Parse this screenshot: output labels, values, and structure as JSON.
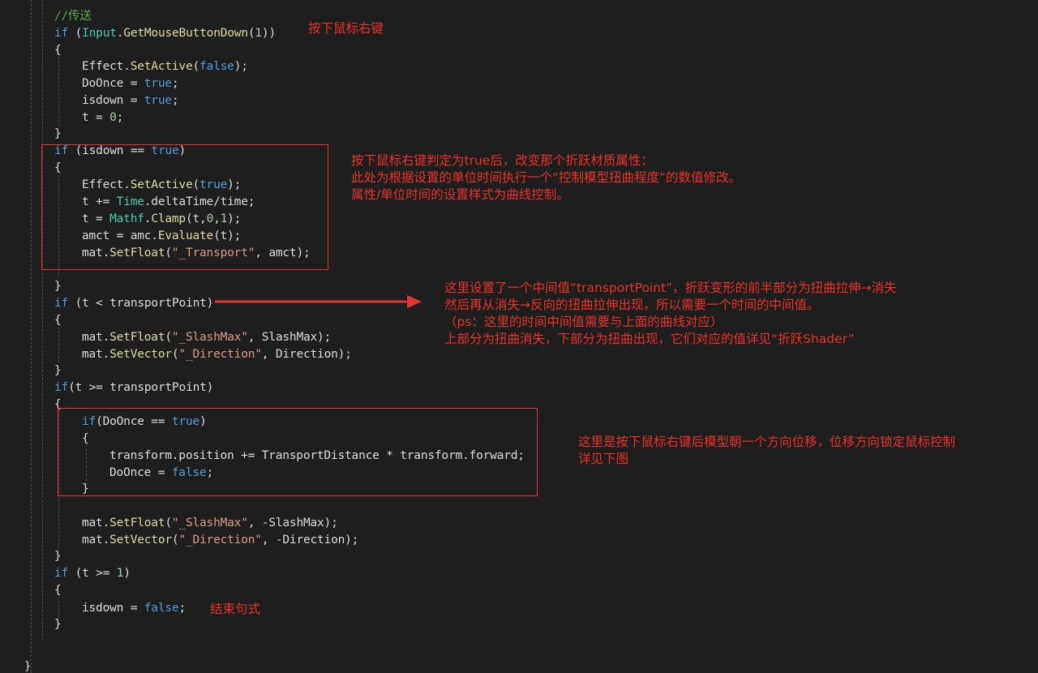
{
  "code_lines": [
    {
      "tokens": [
        {
          "t": "//传送",
          "c": "cm"
        }
      ]
    },
    {
      "tokens": [
        {
          "t": "if",
          "c": "kw"
        },
        {
          "t": " ("
        },
        {
          "t": "Input",
          "c": "ty"
        },
        {
          "t": "."
        },
        {
          "t": "GetMouseButtonDown",
          "c": "mt"
        },
        {
          "t": "("
        },
        {
          "t": "1",
          "c": "nm"
        },
        {
          "t": "))"
        }
      ]
    },
    {
      "tokens": [
        {
          "t": "{"
        }
      ]
    },
    {
      "tokens": [
        {
          "t": "Effect."
        },
        {
          "t": "SetActive",
          "c": "mt"
        },
        {
          "t": "("
        },
        {
          "t": "false",
          "c": "kw"
        },
        {
          "t": ");"
        }
      ]
    },
    {
      "tokens": [
        {
          "t": "DoOnce = "
        },
        {
          "t": "true",
          "c": "kw"
        },
        {
          "t": ";"
        }
      ]
    },
    {
      "tokens": [
        {
          "t": "isdown = "
        },
        {
          "t": "true",
          "c": "kw"
        },
        {
          "t": ";"
        }
      ]
    },
    {
      "tokens": [
        {
          "t": "t = "
        },
        {
          "t": "0",
          "c": "nm"
        },
        {
          "t": ";"
        }
      ]
    },
    {
      "tokens": [
        {
          "t": "}"
        }
      ]
    },
    {
      "tokens": [
        {
          "t": "if",
          "c": "kw"
        },
        {
          "t": " (isdown == "
        },
        {
          "t": "true",
          "c": "kw"
        },
        {
          "t": ")"
        }
      ]
    },
    {
      "tokens": [
        {
          "t": "{"
        }
      ]
    },
    {
      "tokens": [
        {
          "t": "Effect."
        },
        {
          "t": "SetActive",
          "c": "mt"
        },
        {
          "t": "("
        },
        {
          "t": "true",
          "c": "kw"
        },
        {
          "t": ");"
        }
      ]
    },
    {
      "tokens": [
        {
          "t": "t += "
        },
        {
          "t": "Time",
          "c": "ty"
        },
        {
          "t": ".deltaTime/time;"
        }
      ]
    },
    {
      "tokens": [
        {
          "t": "t = "
        },
        {
          "t": "Mathf",
          "c": "ty"
        },
        {
          "t": "."
        },
        {
          "t": "Clamp",
          "c": "mt"
        },
        {
          "t": "(t,"
        },
        {
          "t": "0",
          "c": "nm"
        },
        {
          "t": ","
        },
        {
          "t": "1",
          "c": "nm"
        },
        {
          "t": ");"
        }
      ]
    },
    {
      "tokens": [
        {
          "t": "amct = amc."
        },
        {
          "t": "Evaluate",
          "c": "mt"
        },
        {
          "t": "(t);"
        }
      ]
    },
    {
      "tokens": [
        {
          "t": "mat."
        },
        {
          "t": "SetFloat",
          "c": "mt"
        },
        {
          "t": "("
        },
        {
          "t": "\"_Transport\"",
          "c": "st"
        },
        {
          "t": ", amct);"
        }
      ]
    },
    {
      "tokens": [
        {
          "t": "}"
        }
      ]
    },
    {
      "tokens": [
        {
          "t": "if",
          "c": "kw"
        },
        {
          "t": " (t < transportPoint)"
        }
      ]
    },
    {
      "tokens": [
        {
          "t": "{"
        }
      ]
    },
    {
      "tokens": [
        {
          "t": "mat."
        },
        {
          "t": "SetFloat",
          "c": "mt"
        },
        {
          "t": "("
        },
        {
          "t": "\"_SlashMax\"",
          "c": "st"
        },
        {
          "t": ", SlashMax);"
        }
      ]
    },
    {
      "tokens": [
        {
          "t": "mat."
        },
        {
          "t": "SetVector",
          "c": "mt"
        },
        {
          "t": "("
        },
        {
          "t": "\"_Direction\"",
          "c": "st"
        },
        {
          "t": ", Direction);"
        }
      ]
    },
    {
      "tokens": [
        {
          "t": "}"
        }
      ]
    },
    {
      "tokens": [
        {
          "t": "if",
          "c": "kw"
        },
        {
          "t": "(t >= transportPoint)"
        }
      ]
    },
    {
      "tokens": [
        {
          "t": "{"
        }
      ]
    },
    {
      "tokens": [
        {
          "t": "if",
          "c": "kw"
        },
        {
          "t": "(DoOnce == "
        },
        {
          "t": "true",
          "c": "kw"
        },
        {
          "t": ")"
        }
      ]
    },
    {
      "tokens": [
        {
          "t": "{"
        }
      ]
    },
    {
      "tokens": [
        {
          "t": "transform.position += TransportDistance * transform.forward;"
        }
      ]
    },
    {
      "tokens": [
        {
          "t": "DoOnce = "
        },
        {
          "t": "false",
          "c": "kw"
        },
        {
          "t": ";"
        }
      ]
    },
    {
      "tokens": [
        {
          "t": "}"
        }
      ]
    },
    {
      "tokens": [
        {
          "t": "mat."
        },
        {
          "t": "SetFloat",
          "c": "mt"
        },
        {
          "t": "("
        },
        {
          "t": "\"_SlashMax\"",
          "c": "st"
        },
        {
          "t": ", -SlashMax);"
        }
      ]
    },
    {
      "tokens": [
        {
          "t": "mat."
        },
        {
          "t": "SetVector",
          "c": "mt"
        },
        {
          "t": "("
        },
        {
          "t": "\"_Direction\"",
          "c": "st"
        },
        {
          "t": ", -Direction);"
        }
      ]
    },
    {
      "tokens": [
        {
          "t": "}"
        }
      ]
    },
    {
      "tokens": [
        {
          "t": "if",
          "c": "kw"
        },
        {
          "t": " (t >= "
        },
        {
          "t": "1",
          "c": "nm"
        },
        {
          "t": ")"
        }
      ]
    },
    {
      "tokens": [
        {
          "t": "{"
        }
      ]
    },
    {
      "tokens": [
        {
          "t": "isdown = "
        },
        {
          "t": "false",
          "c": "kw"
        },
        {
          "t": ";"
        }
      ]
    },
    {
      "tokens": [
        {
          "t": "}"
        }
      ]
    }
  ],
  "annotations": {
    "right_click": "按下鼠标右键",
    "isdown_block": [
      "按下鼠标右键判定为true后，改变那个折跃材质属性：",
      "此处为根据设置的单位时间执行一个“控制模型扭曲程度”的数值修改。",
      "属性/单位时间的设置样式为曲线控制。"
    ],
    "transport_point": [
      "这里设置了一个中间值“transportPoint”，折跃变形的前半部分为扭曲拉伸→消失",
      "然后再从消失→反向的扭曲拉伸出现，所以需要一个时间的中间值。",
      "（ps：这里的时间中间值需要与上面的曲线对应）",
      "上部分为扭曲消失，下部分为扭曲出现，它们对应的值详见“折跃Shader”"
    ],
    "displacement": [
      "这里是按下鼠标右键后模型朝一个方向位移，位移方向锁定鼠标控制",
      "详见下图"
    ],
    "end_statement": "结束句式"
  },
  "colors": {
    "background": "#1e1e1e",
    "annotation_red": "#e8322b",
    "keyword": "#569cd6",
    "comment": "#57a64a",
    "type": "#4ec9b0",
    "method": "#dcdcaa",
    "string": "#d69d85"
  }
}
